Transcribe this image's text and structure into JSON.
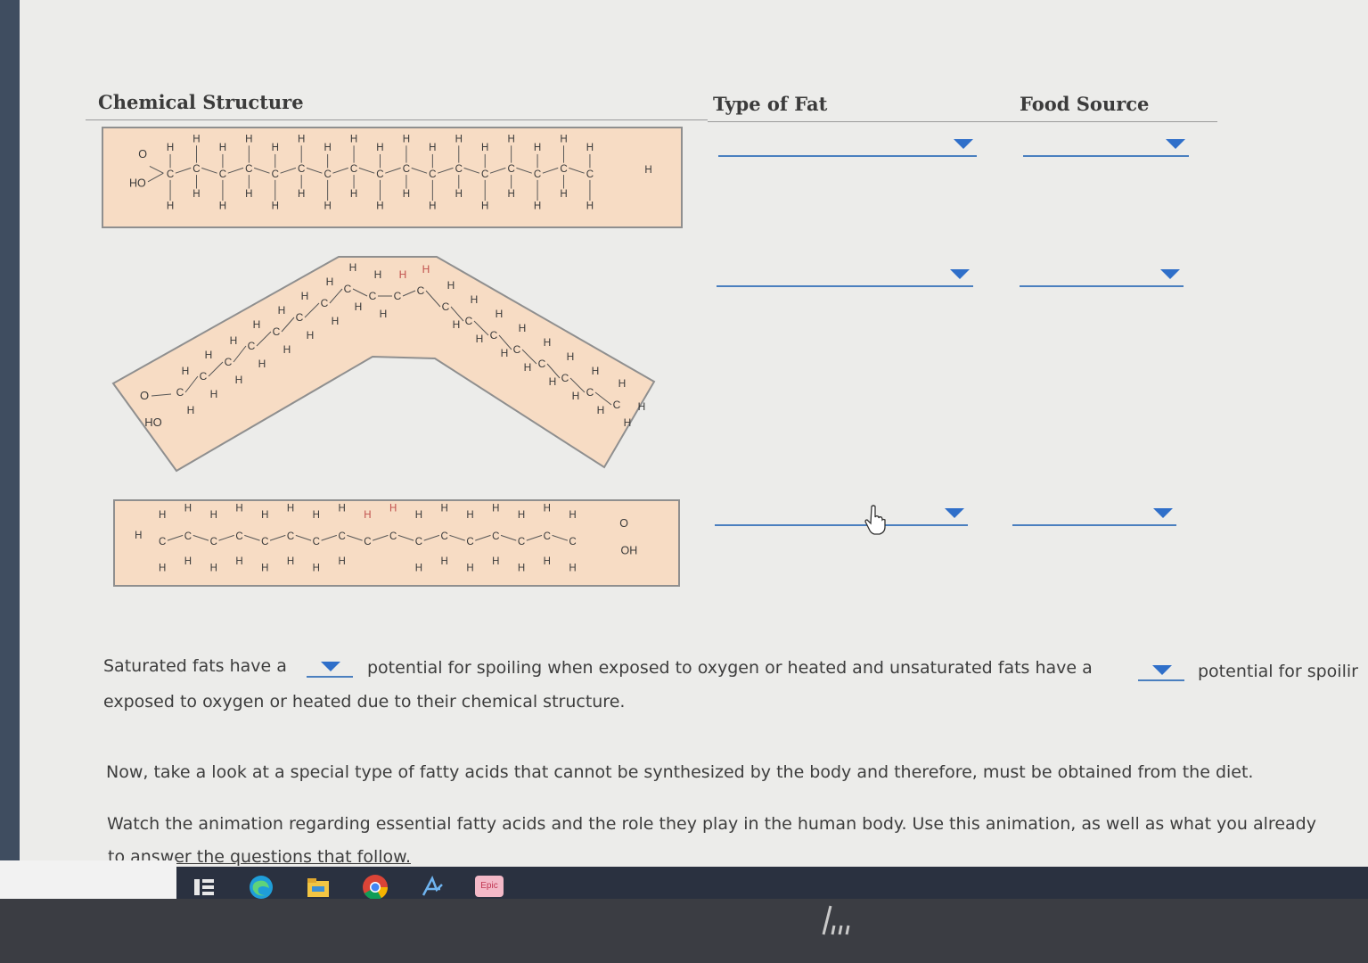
{
  "headers": {
    "chemical_structure": "Chemical Structure",
    "type_of_fat": "Type of Fat",
    "food_source": "Food Source"
  },
  "rows": [
    {
      "type_value": "",
      "source_value": ""
    },
    {
      "type_value": "",
      "source_value": ""
    },
    {
      "type_value": "",
      "source_value": ""
    }
  ],
  "sentence": {
    "part1": "Saturated fats have a",
    "part2": "potential for spoiling when exposed to oxygen or heated and unsaturated fats have a",
    "part3": "potential for spoilir",
    "line2": "exposed to oxygen or heated due to their chemical structure."
  },
  "paragraph1": "Now, take a look at a special type of fatty acids that cannot be synthesized by the body and therefore, must be obtained from the diet.",
  "paragraph2_line1": "Watch the animation regarding essential fatty acids and the role they play in the human body. Use this animation, as well as what you already",
  "paragraph2_line2": "to answer the questions that follow.",
  "molecule_labels": {
    "ho": "HO",
    "o": "O",
    "oh": "OH",
    "h": "H",
    "c": "C"
  },
  "taskbar": {
    "apps": [
      "task-view-icon",
      "edge-icon",
      "file-explorer-icon",
      "chrome-icon",
      "app-icon",
      "epic-icon"
    ],
    "epic_label": "Epic"
  },
  "colors": {
    "panel": "#f7dcc4",
    "dropdown_accent": "#2f6fc9",
    "highlight_h": "#e8a0a0"
  }
}
